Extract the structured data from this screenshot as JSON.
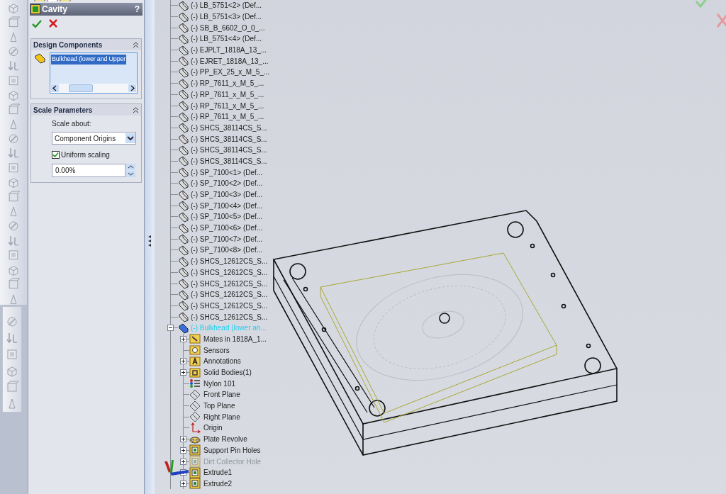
{
  "property_manager": {
    "title": "Cavity",
    "help": "?",
    "design_components": {
      "title": "Design Components",
      "items": [
        {
          "label": "Bulkhead (lower and Upper",
          "selected": true
        }
      ]
    },
    "scale_parameters": {
      "title": "Scale Parameters",
      "scale_about_label": "Scale about:",
      "scale_about": "Component Origins",
      "uniform_scaling": {
        "label": "Uniform scaling",
        "checked": true
      },
      "scale_value": "0.00%"
    }
  },
  "tree": [
    {
      "label": "(-) LB_5751<2> (Def...",
      "highlighted": false
    },
    {
      "label": "(-) LB_5751<3> (Def...",
      "highlighted": false
    },
    {
      "label": "(-) SB_B_6602_O_0_...",
      "highlighted": false
    },
    {
      "label": "(-) LB_5751<4> (Def...",
      "highlighted": false
    },
    {
      "label": "(-) EJPLT_1818A_13_...",
      "highlighted": false
    },
    {
      "label": "(-) EJRET_1818A_13_...",
      "highlighted": false
    },
    {
      "label": "(-) PP_EX_25_x_M_5_...",
      "highlighted": false
    },
    {
      "label": "(-) RP_7611_x_M_5_...",
      "highlighted": false
    },
    {
      "label": "(-) RP_7611_x_M_5_...",
      "highlighted": false
    },
    {
      "label": "(-) RP_7611_x_M_5_...",
      "highlighted": false
    },
    {
      "label": "(-) RP_7611_x_M_5_...",
      "highlighted": false
    },
    {
      "label": "(-) SHCS_38114CS_S...",
      "highlighted": false
    },
    {
      "label": "(-) SHCS_38114CS_S...",
      "highlighted": false
    },
    {
      "label": "(-) SHCS_38114CS_S...",
      "highlighted": false
    },
    {
      "label": "(-) SHCS_38114CS_S...",
      "highlighted": false
    },
    {
      "label": "(-) SP_7100<1> (Def...",
      "highlighted": false
    },
    {
      "label": "(-) SP_7100<2> (Def...",
      "highlighted": false
    },
    {
      "label": "(-) SP_7100<3> (Def...",
      "highlighted": false
    },
    {
      "label": "(-) SP_7100<4> (Def...",
      "highlighted": false
    },
    {
      "label": "(-) SP_7100<5> (Def...",
      "highlighted": false
    },
    {
      "label": "(-) SP_7100<6> (Def...",
      "highlighted": false
    },
    {
      "label": "(-) SP_7100<7> (Def...",
      "highlighted": false
    },
    {
      "label": "(-) SP_7100<8> (Def...",
      "highlighted": false
    },
    {
      "label": "(-) SHCS_12612CS_S...",
      "highlighted": false
    },
    {
      "label": "(-) SHCS_12612CS_S...",
      "highlighted": false
    },
    {
      "label": "(-) SHCS_12612CS_S...",
      "highlighted": false
    },
    {
      "label": "(-) SHCS_12612CS_S...",
      "highlighted": false
    },
    {
      "label": "(-) SHCS_12612CS_S...",
      "highlighted": false
    },
    {
      "label": "(-) SHCS_12612CS_S...",
      "highlighted": false
    },
    {
      "label": "(-) Bulkhead (lower an...",
      "highlighted": true,
      "expanded": true,
      "children": [
        {
          "kind": "mates",
          "label": "Mates in 1818A_1...",
          "expandable": true,
          "suppressed": false
        },
        {
          "kind": "sensors",
          "label": "Sensors",
          "expandable": false,
          "suppressed": false
        },
        {
          "kind": "annotations",
          "label": "Annotations",
          "expandable": true,
          "suppressed": false
        },
        {
          "kind": "bodies",
          "label": "Solid Bodies(1)",
          "expandable": true,
          "suppressed": false
        },
        {
          "kind": "material",
          "label": "Nylon 101",
          "expandable": false,
          "suppressed": false
        },
        {
          "kind": "plane",
          "label": "Front Plane",
          "expandable": false,
          "suppressed": false
        },
        {
          "kind": "plane",
          "label": "Top Plane",
          "expandable": false,
          "suppressed": false
        },
        {
          "kind": "plane",
          "label": "Right Plane",
          "expandable": false,
          "suppressed": false
        },
        {
          "kind": "origin",
          "label": "Origin",
          "expandable": false,
          "suppressed": false
        },
        {
          "kind": "revolve",
          "label": "Plate Revolve",
          "expandable": true,
          "suppressed": false
        },
        {
          "kind": "feature",
          "label": "Support Pin Holes",
          "expandable": true,
          "suppressed": false
        },
        {
          "kind": "feature",
          "label": "Dirt Collector Hole",
          "expandable": true,
          "suppressed": true
        },
        {
          "kind": "feature",
          "label": "Extrude1",
          "expandable": true,
          "suppressed": false
        },
        {
          "kind": "feature",
          "label": "Extrude2",
          "expandable": true,
          "suppressed": false
        }
      ]
    }
  ]
}
